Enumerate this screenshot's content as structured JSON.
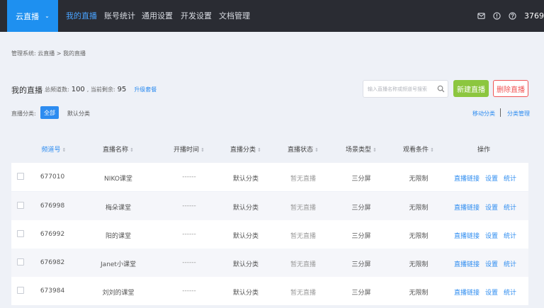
{
  "topnav": {
    "brand": "云直播",
    "brand_chevron": "⌄",
    "items": [
      "我的直播",
      "账号统计",
      "通用设置",
      "开发设置",
      "文档管理"
    ],
    "user_id": "3769",
    "icons": [
      "mail-icon",
      "info-icon",
      "help-icon"
    ]
  },
  "breadcrumb": "管理系统:   云直播 > 我的直播",
  "title": {
    "heading": "我的直播",
    "total_label": "总频道数:",
    "total_value": "100",
    "remain_label": ", 当前剩余:",
    "remain_value": "95",
    "upgrade_link": "升级套餐"
  },
  "search": {
    "placeholder": "输入直播名称或频道号搜索"
  },
  "buttons": {
    "new": "新建直播",
    "delete": "删除直播"
  },
  "filter": {
    "label": "直播分类:",
    "all": "全部",
    "default": "默认分类",
    "move": "移动分类",
    "manage": "分类管理"
  },
  "table": {
    "headers": [
      "频道号",
      "直播名称",
      "开播时间",
      "直播分类",
      "直播状态",
      "场景类型",
      "观看条件",
      "操作"
    ],
    "rows": [
      [
        "677010",
        "NIKO课堂",
        "------",
        "默认分类",
        "暂无直播",
        "三分屏",
        "无限制"
      ],
      [
        "676998",
        "梅朵课堂",
        "------",
        "默认分类",
        "暂无直播",
        "三分屏",
        "无限制"
      ],
      [
        "676992",
        "阳的课堂",
        "------",
        "默认分类",
        "暂无直播",
        "三分屏",
        "无限制"
      ],
      [
        "676982",
        "Janet小课堂",
        "------",
        "默认分类",
        "暂无直播",
        "三分屏",
        "无限制"
      ],
      [
        "673984",
        "刘刘的课堂",
        "------",
        "默认分类",
        "暂无直播",
        "三分屏",
        "无限制"
      ]
    ],
    "ops": [
      "直播链接",
      "设置",
      "统计"
    ]
  },
  "colors": {
    "accent": "#2d8cf0",
    "brand": "#1e90f0",
    "nav_bg": "#2a2c33",
    "new_button": "#8cc63f",
    "delete": "#f05454"
  }
}
